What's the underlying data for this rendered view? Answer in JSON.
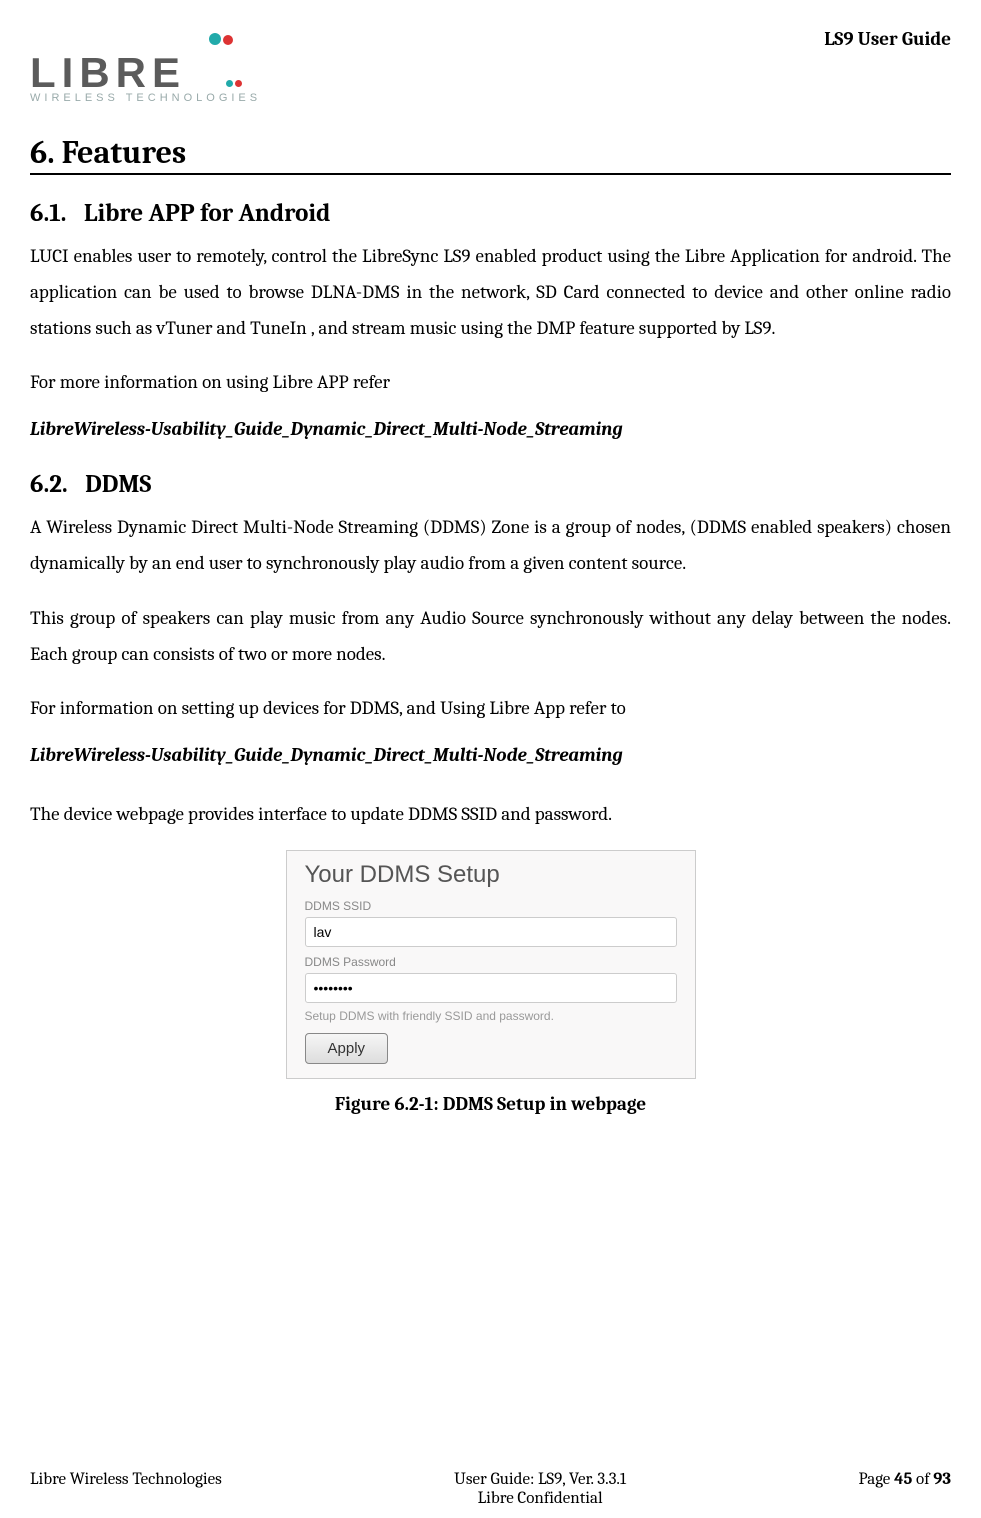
{
  "header": {
    "logo_main": "LIBRE",
    "logo_sub": "WIRELESS TECHNOLOGIES",
    "doc_title": "LS9 User Guide"
  },
  "h1": {
    "num": "6.",
    "title": "Features"
  },
  "s61": {
    "num": "6.1.",
    "title": "Libre APP for Android",
    "p1": "LUCI enables user to remotely, control the LibreSync LS9 enabled product using the Libre Application for android. The application can be used to browse DLNA-DMS in the network, SD Card connected to device and other online radio stations such as vTuner and TuneIn , and stream music using the DMP feature supported by LS9.",
    "p2": "For more information on using Libre APP refer",
    "ref": "LibreWireless-Usability_Guide_Dynamic_Direct_Multi-Node_Streaming"
  },
  "s62": {
    "num": "6.2.",
    "title": "DDMS",
    "p1": "A Wireless Dynamic Direct Multi-Node Streaming (DDMS) Zone is a group of nodes, (DDMS enabled speakers) chosen dynamically by an end user to synchronously play audio from a given content source.",
    "p2": "This group of speakers can play music from any Audio Source synchronously without any delay between the nodes. Each group can consists of two or more nodes.",
    "p3": "For information on setting up devices for DDMS, and Using Libre App refer to",
    "ref": "LibreWireless-Usability_Guide_Dynamic_Direct_Multi-Node_Streaming",
    "p4": "The device webpage provides interface to update DDMS SSID and password."
  },
  "figure": {
    "title": "Your DDMS Setup",
    "ssid_label": "DDMS SSID",
    "ssid_value": "lav",
    "pwd_label": "DDMS Password",
    "pwd_value": "••••••••",
    "help": "Setup DDMS with friendly SSID and password.",
    "button": "Apply",
    "caption": "Figure 6.2-1: DDMS Setup in webpage"
  },
  "footer": {
    "left": "Libre Wireless Technologies",
    "center": "User Guide: LS9, Ver. 3.3.1",
    "confidential": "Libre Confidential",
    "page_prefix": "Page ",
    "page_num": "45",
    "page_of": " of ",
    "page_total": "93"
  }
}
